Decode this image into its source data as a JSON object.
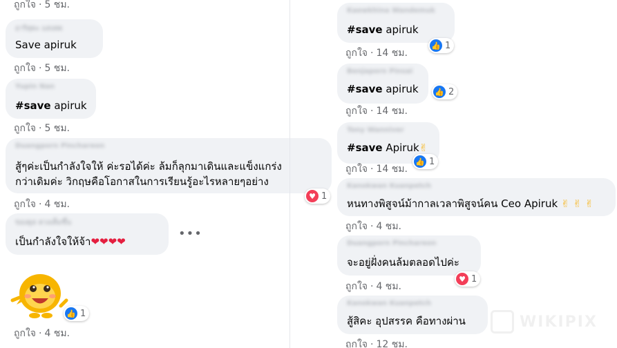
{
  "like_label": "ถูกใจ",
  "left_column": {
    "top_meta_time": "5 ชม.",
    "comments": [
      {
        "author": "อาริสุดะ แสงสด",
        "text": "Save apiruk",
        "time": "5 ชม."
      },
      {
        "author": "Yupin Nan",
        "text_bold": "#save",
        "text_rest": " apiruk",
        "time": "5 ชม."
      },
      {
        "author": "Duangporn Pinchareon",
        "line1": "สู้ๆค่ะเป็นกำลังใจให้ ค่ะรอได้ค่ะ ล้มก็ลุกมาเดินและแข็งแกร่ง",
        "line2": "กว่าเดิมค่ะ วิกฤษคือโอกาสในการเรียนรู้อะไรหลายๆอย่าง",
        "time": "4 ชม.",
        "reaction_count": "1"
      },
      {
        "author": "ของดูล ดวงเต็มขึ้น",
        "text": "เป็นกำลังใจให้จ้า",
        "hearts": "❤❤❤❤",
        "time": "4 ชม.",
        "more": "•••"
      },
      {
        "sticker": "smiling-sticker",
        "time": "4 ชม.",
        "reaction_count": "1"
      }
    ]
  },
  "right_column": {
    "comments": [
      {
        "author": "Kaewkhina Wandemuk",
        "text_bold": "#save",
        "text_rest": " apiruk",
        "time": "14 ชม.",
        "reaction_count": "1"
      },
      {
        "author": "Benjaporn Pinsai",
        "text_bold": "#save",
        "text_rest": " apiruk",
        "time": "14 ชม.",
        "reaction_count": "2"
      },
      {
        "author": "Tony Wanniver",
        "text_bold": "#save",
        "text_rest": " Apiruk",
        "emoji": "✌",
        "time": "14 ชม.",
        "reaction_count": "1"
      },
      {
        "author": "Kanokwan Kuanpetch",
        "text": "หนทางพิสูจน์ม้ากาลเวลาพิสูจน์คน Ceo Apiruk",
        "emoji": "✌ ✌ ✌",
        "time": "4 ชม."
      },
      {
        "author": "Duangporn Pinchareon",
        "text": "จะอยู่ฝั่งคนล้มตลอดไปค่ะ",
        "time": "4 ชม.",
        "reaction_count": "1"
      },
      {
        "author": "Kanokwan Kuanpetch",
        "text": "สู้สิคะ อุปสรรค คือทางผ่าน",
        "time": "12 ชม."
      }
    ]
  },
  "watermark": "WIKIPIX",
  "colors": {
    "bubble": "#f0f2f5",
    "meta": "#65676b",
    "like_blue": "#1877f2",
    "love_red": "#f33e58"
  }
}
